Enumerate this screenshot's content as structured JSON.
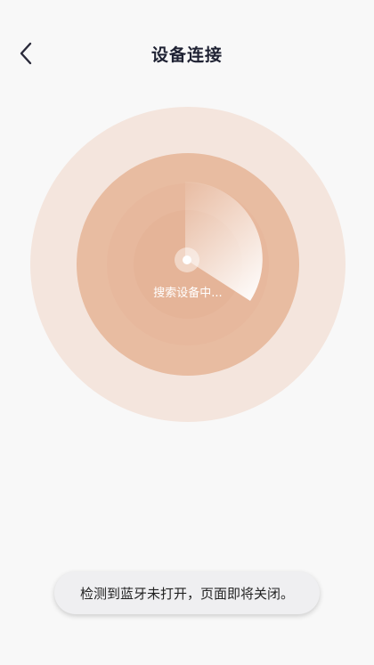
{
  "header": {
    "title": "设备连接",
    "back_icon": "chevron-left-icon"
  },
  "radar": {
    "status_text": "搜索设备中...",
    "colors": {
      "outer": "#f4e5dd",
      "middle": "#e8bca1",
      "inner": "#e5b498"
    }
  },
  "toast": {
    "message": "检测到蓝牙未打开，页面即将关闭。"
  }
}
